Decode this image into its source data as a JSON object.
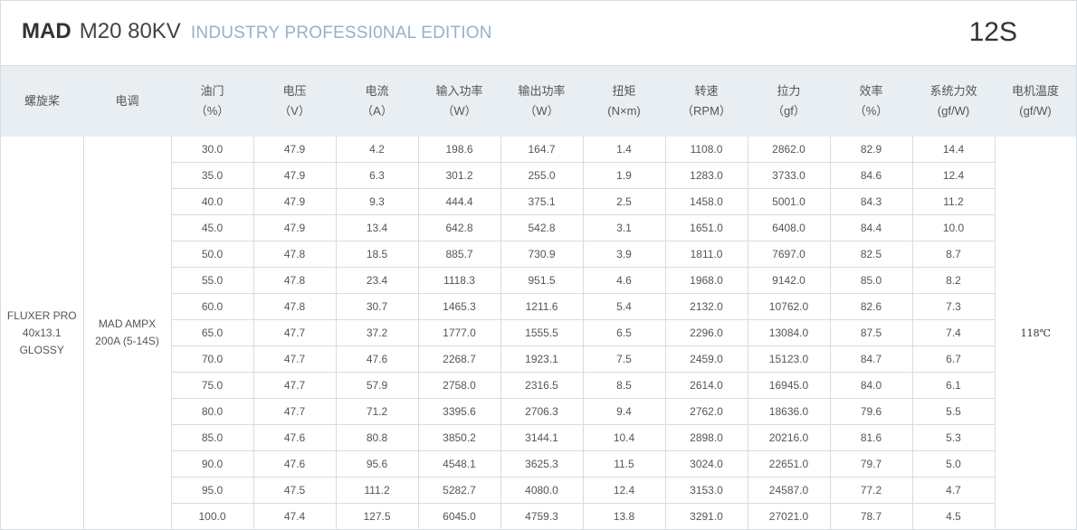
{
  "header": {
    "brand": "MAD",
    "model": "M20 80KV",
    "edition": "INDUSTRY PROFESSI0NAL EDITION",
    "cells": "12S"
  },
  "columns": [
    {
      "name": "螺旋桨",
      "unit": ""
    },
    {
      "name": "电调",
      "unit": ""
    },
    {
      "name": "油门",
      "unit": "（%）"
    },
    {
      "name": "电压",
      "unit": "（V）"
    },
    {
      "name": "电流",
      "unit": "（A）"
    },
    {
      "name": "输入功率",
      "unit": "（W）"
    },
    {
      "name": "输出功率",
      "unit": "（W）"
    },
    {
      "name": "扭矩",
      "unit": "(N×m)"
    },
    {
      "name": "转速",
      "unit": "（RPM）"
    },
    {
      "name": "拉力",
      "unit": "（gf）"
    },
    {
      "name": "效率",
      "unit": "（%）"
    },
    {
      "name": "系统力效",
      "unit": "(gf/W)"
    },
    {
      "name": "电机温度",
      "unit": "(gf/W)"
    }
  ],
  "propeller": [
    "FLUXER PRO",
    "40x13.1",
    "GLOSSY"
  ],
  "esc": [
    "MAD AMPX",
    "200A (5-14S)"
  ],
  "motor_temp": "118℃",
  "rows": [
    [
      "30.0",
      "47.9",
      "4.2",
      "198.6",
      "164.7",
      "1.4",
      "1108.0",
      "2862.0",
      "82.9",
      "14.4"
    ],
    [
      "35.0",
      "47.9",
      "6.3",
      "301.2",
      "255.0",
      "1.9",
      "1283.0",
      "3733.0",
      "84.6",
      "12.4"
    ],
    [
      "40.0",
      "47.9",
      "9.3",
      "444.4",
      "375.1",
      "2.5",
      "1458.0",
      "5001.0",
      "84.3",
      "11.2"
    ],
    [
      "45.0",
      "47.9",
      "13.4",
      "642.8",
      "542.8",
      "3.1",
      "1651.0",
      "6408.0",
      "84.4",
      "10.0"
    ],
    [
      "50.0",
      "47.8",
      "18.5",
      "885.7",
      "730.9",
      "3.9",
      "1811.0",
      "7697.0",
      "82.5",
      "8.7"
    ],
    [
      "55.0",
      "47.8",
      "23.4",
      "1118.3",
      "951.5",
      "4.6",
      "1968.0",
      "9142.0",
      "85.0",
      "8.2"
    ],
    [
      "60.0",
      "47.8",
      "30.7",
      "1465.3",
      "1211.6",
      "5.4",
      "2132.0",
      "10762.0",
      "82.6",
      "7.3"
    ],
    [
      "65.0",
      "47.7",
      "37.2",
      "1777.0",
      "1555.5",
      "6.5",
      "2296.0",
      "13084.0",
      "87.5",
      "7.4"
    ],
    [
      "70.0",
      "47.7",
      "47.6",
      "2268.7",
      "1923.1",
      "7.5",
      "2459.0",
      "15123.0",
      "84.7",
      "6.7"
    ],
    [
      "75.0",
      "47.7",
      "57.9",
      "2758.0",
      "2316.5",
      "8.5",
      "2614.0",
      "16945.0",
      "84.0",
      "6.1"
    ],
    [
      "80.0",
      "47.7",
      "71.2",
      "3395.6",
      "2706.3",
      "9.4",
      "2762.0",
      "18636.0",
      "79.6",
      "5.5"
    ],
    [
      "85.0",
      "47.6",
      "80.8",
      "3850.2",
      "3144.1",
      "10.4",
      "2898.0",
      "20216.0",
      "81.6",
      "5.3"
    ],
    [
      "90.0",
      "47.6",
      "95.6",
      "4548.1",
      "3625.3",
      "11.5",
      "3024.0",
      "22651.0",
      "79.7",
      "5.0"
    ],
    [
      "95.0",
      "47.5",
      "111.2",
      "5282.7",
      "4080.0",
      "12.4",
      "3153.0",
      "24587.0",
      "77.2",
      "4.7"
    ],
    [
      "100.0",
      "47.4",
      "127.5",
      "6045.0",
      "4759.3",
      "13.8",
      "3291.0",
      "27021.0",
      "78.7",
      "4.5"
    ]
  ]
}
